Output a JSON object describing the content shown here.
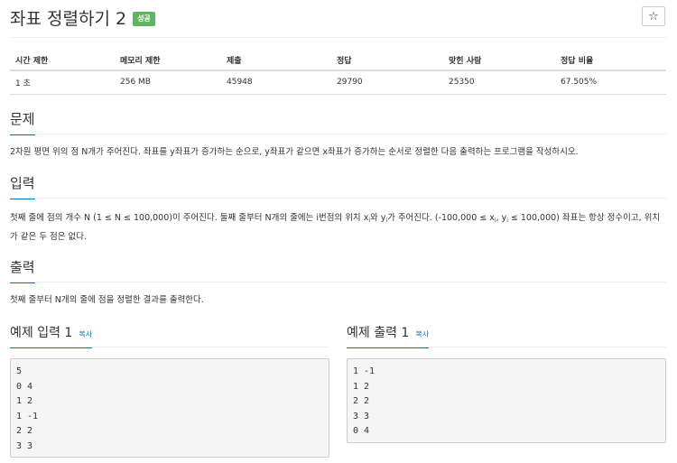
{
  "problem": {
    "title": "좌표 정렬하기 2",
    "badge": "성공",
    "star_icon": "☆"
  },
  "info_table": {
    "headers": [
      "시간 제한",
      "메모리 제한",
      "제출",
      "정답",
      "맞힌 사람",
      "정답 비율"
    ],
    "values": [
      "1 초",
      "256 MB",
      "45948",
      "29790",
      "25350",
      "67.505%"
    ]
  },
  "sections": {
    "problem_head": "문제",
    "problem_text": "2차원 평면 위의 점 N개가 주어진다. 좌표를 y좌표가 증가하는 순으로, y좌표가 같으면 x좌표가 증가하는 순서로 정렬한 다음 출력하는 프로그램을 작성하시오.",
    "input_head": "입력",
    "input_text_1": "첫째 줄에 점의 개수 N (1 ≤ N ≤ 100,000)이 주어진다. 둘째 줄부터 N개의 줄에는 i번점의 위치 x",
    "input_sub_i_1": "i",
    "input_text_2": "와 y",
    "input_sub_i_2": "i",
    "input_text_3": "가 주어진다. (-100,000 ≤ x",
    "input_sub_i_3": "i",
    "input_text_4": ", y",
    "input_sub_i_4": "i",
    "input_text_5": " ≤ 100,000) 좌표는 항상 정수이고, 위치가 같은 두 점은 없다.",
    "output_head": "출력",
    "output_text": "첫째 줄부터 N개의 줄에 점을 정렬한 결과를 출력한다."
  },
  "examples": {
    "input_title": "예제 입력 1",
    "input_copy": "복사",
    "input_lines": [
      "5",
      "0 4",
      "1 2",
      "1 -1",
      "2 2",
      "3 3"
    ],
    "output_title": "예제 출력 1",
    "output_copy": "복사",
    "output_lines": [
      "1 -1",
      "1 2",
      "2 2",
      "3 3",
      "0 4"
    ]
  }
}
